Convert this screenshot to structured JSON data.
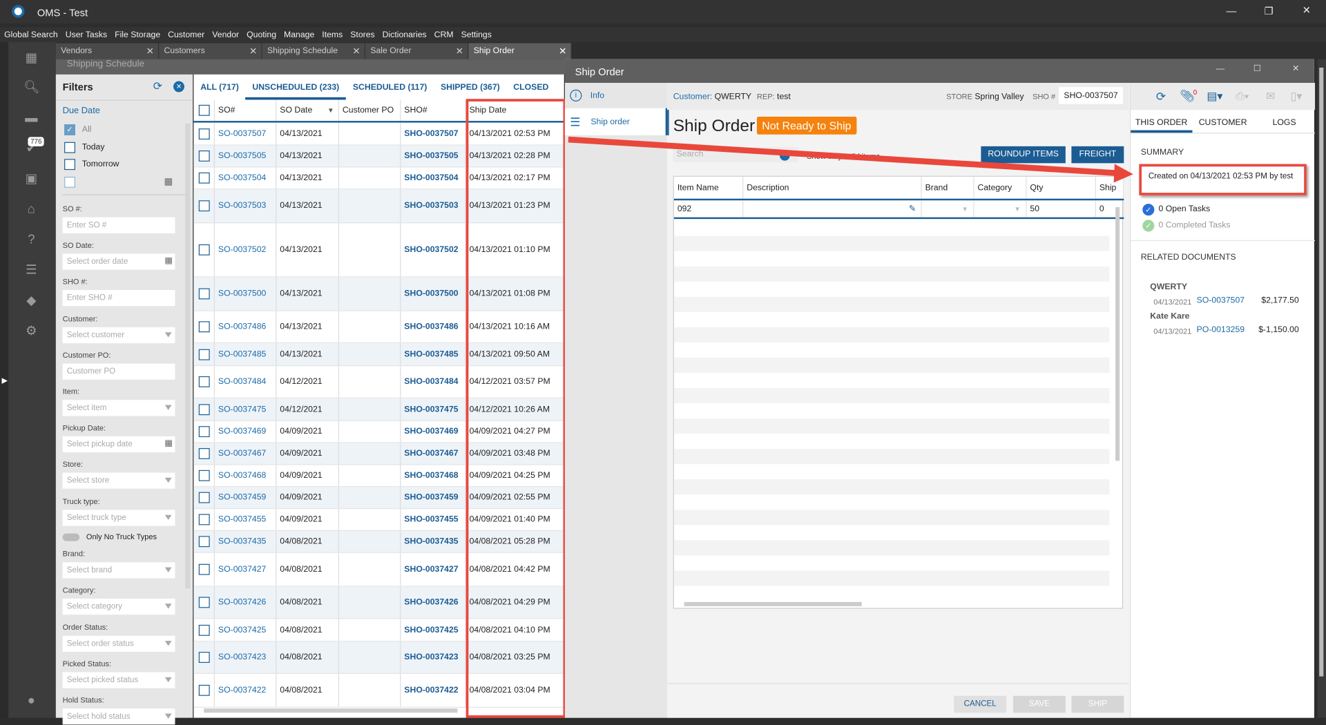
{
  "app": {
    "title": "OMS - Test"
  },
  "menu": [
    "Global Search",
    "User Tasks",
    "File Storage",
    "Customer",
    "Vendor",
    "Quoting",
    "Manage",
    "Items",
    "Stores",
    "Dictionaries",
    "CRM",
    "Settings"
  ],
  "nav": {
    "badge": "776"
  },
  "tabs": [
    "Vendors",
    "Customers",
    "Shipping Schedule",
    "Sale Order",
    "Ship Order"
  ],
  "subheader": "Shipping Schedule",
  "filters": {
    "title": "Filters",
    "due_date": "Due Date",
    "opts": [
      "All",
      "Today",
      "Tomorrow"
    ],
    "fields": [
      {
        "label": "SO #:",
        "ph": "Enter SO #",
        "kind": "text"
      },
      {
        "label": "SO Date:",
        "ph": "Select order date",
        "kind": "date"
      },
      {
        "label": "SHO #:",
        "ph": "Enter SHO #",
        "kind": "text"
      },
      {
        "label": "Customer:",
        "ph": "Select customer",
        "kind": "dd"
      },
      {
        "label": "Customer PO:",
        "ph": "Customer PO",
        "kind": "text"
      },
      {
        "label": "Item:",
        "ph": "Select item",
        "kind": "dd"
      },
      {
        "label": "Pickup Date:",
        "ph": "Select pickup date",
        "kind": "date"
      },
      {
        "label": "Store:",
        "ph": "Select store",
        "kind": "dd"
      },
      {
        "label": "Truck type:",
        "ph": "Select truck type",
        "kind": "dd"
      }
    ],
    "toggle": "Only No Truck Types",
    "fields2": [
      {
        "label": "Brand:",
        "ph": "Select brand"
      },
      {
        "label": "Category:",
        "ph": "Select category"
      },
      {
        "label": "Order Status:",
        "ph": "Select order status"
      },
      {
        "label": "Picked Status:",
        "ph": "Select picked status"
      },
      {
        "label": "Hold Status:",
        "ph": "Select hold status"
      }
    ]
  },
  "grid": {
    "tabs": [
      "ALL (717)",
      "UNSCHEDULED (233)",
      "SCHEDULED (117)",
      "SHIPPED (367)",
      "CLOSED"
    ],
    "columns": [
      "SO#",
      "SO Date",
      "Customer PO",
      "SHO#",
      "Ship Date"
    ],
    "rows": [
      [
        "SO-0037507",
        "04/13/2021",
        "",
        "SHO-0037507",
        "04/13/2021 02:53 PM"
      ],
      [
        "SO-0037505",
        "04/13/2021",
        "",
        "SHO-0037505",
        "04/13/2021 02:28 PM"
      ],
      [
        "SO-0037504",
        "04/13/2021",
        "",
        "SHO-0037504",
        "04/13/2021 02:17 PM"
      ],
      [
        "SO-0037503",
        "04/13/2021",
        "",
        "SHO-0037503",
        "04/13/2021 01:23 PM"
      ],
      [
        "SO-0037502",
        "04/13/2021",
        "",
        "SHO-0037502",
        "04/13/2021 01:10 PM"
      ],
      [
        "SO-0037500",
        "04/13/2021",
        "",
        "SHO-0037500",
        "04/13/2021 01:08 PM"
      ],
      [
        "SO-0037486",
        "04/13/2021",
        "",
        "SHO-0037486",
        "04/13/2021 10:16 AM"
      ],
      [
        "SO-0037485",
        "04/13/2021",
        "",
        "SHO-0037485",
        "04/13/2021 09:50 AM"
      ],
      [
        "SO-0037484",
        "04/12/2021",
        "",
        "SHO-0037484",
        "04/12/2021 03:57 PM"
      ],
      [
        "SO-0037475",
        "04/12/2021",
        "",
        "SHO-0037475",
        "04/12/2021 10:26 AM"
      ],
      [
        "SO-0037469",
        "04/09/2021",
        "",
        "SHO-0037469",
        "04/09/2021 04:27 PM"
      ],
      [
        "SO-0037467",
        "04/09/2021",
        "",
        "SHO-0037467",
        "04/09/2021 03:48 PM"
      ],
      [
        "SO-0037468",
        "04/09/2021",
        "",
        "SHO-0037468",
        "04/09/2021 04:25 PM"
      ],
      [
        "SO-0037459",
        "04/09/2021",
        "",
        "SHO-0037459",
        "04/09/2021 02:55 PM"
      ],
      [
        "SO-0037455",
        "04/09/2021",
        "",
        "SHO-0037455",
        "04/09/2021 01:40 PM"
      ],
      [
        "SO-0037435",
        "04/08/2021",
        "",
        "SHO-0037435",
        "04/08/2021 05:28 PM"
      ],
      [
        "SO-0037427",
        "04/08/2021",
        "",
        "SHO-0037427",
        "04/08/2021 04:42 PM"
      ],
      [
        "SO-0037426",
        "04/08/2021",
        "",
        "SHO-0037426",
        "04/08/2021 04:29 PM"
      ],
      [
        "SO-0037425",
        "04/08/2021",
        "",
        "SHO-0037425",
        "04/08/2021 04:10 PM"
      ],
      [
        "SO-0037423",
        "04/08/2021",
        "",
        "SHO-0037423",
        "04/08/2021 03:25 PM"
      ],
      [
        "SO-0037422",
        "04/08/2021",
        "",
        "SHO-0037422",
        "04/08/2021 03:04 PM"
      ]
    ]
  },
  "dialog": {
    "title": "Ship Order",
    "nav": [
      "Info",
      "Ship order"
    ],
    "header": {
      "customer_label": "Customer:",
      "customer": "QWERTY",
      "rep_label": "REP:",
      "rep": "test",
      "store_label": "STORE",
      "store": "Spring Valley",
      "sho_label": "SHO #",
      "sho": "SHO-0037507",
      "attach_count": "0"
    },
    "heading": "Ship Order",
    "status": "Not Ready to Ship",
    "search_ph": "Search",
    "valid_toggle": "Show only valid items",
    "roundup": "ROUNDUP ITEMS",
    "freight": "FREIGHT",
    "item_columns": [
      "Item Name",
      "Description",
      "Brand",
      "Category",
      "Qty",
      "Ship"
    ],
    "item_rows": [
      [
        "092",
        "",
        "",
        "",
        "50",
        "0"
      ]
    ],
    "buttons": {
      "cancel": "CANCEL",
      "save": "SAVE",
      "ship": "SHIP"
    },
    "side_tabs": [
      "THIS ORDER",
      "CUSTOMER",
      "LOGS"
    ],
    "summary_title": "SUMMARY",
    "summary": "Created on 04/13/2021 02:53 PM by test",
    "open_tasks": "0 Open Tasks",
    "completed_tasks": "0 Completed Tasks",
    "related_title": "RELATED DOCUMENTS",
    "related": [
      {
        "party": "QWERTY",
        "date": "04/13/2021",
        "doc": "SO-0037507",
        "amount": "$2,177.50"
      },
      {
        "party": "Kate Kare",
        "date": "04/13/2021",
        "doc": "PO-0013259",
        "amount": "$-1,150.00"
      }
    ]
  },
  "colors": {
    "accent": "#1b5c93",
    "status": "#f5820d",
    "highlight": "#e9473c"
  }
}
